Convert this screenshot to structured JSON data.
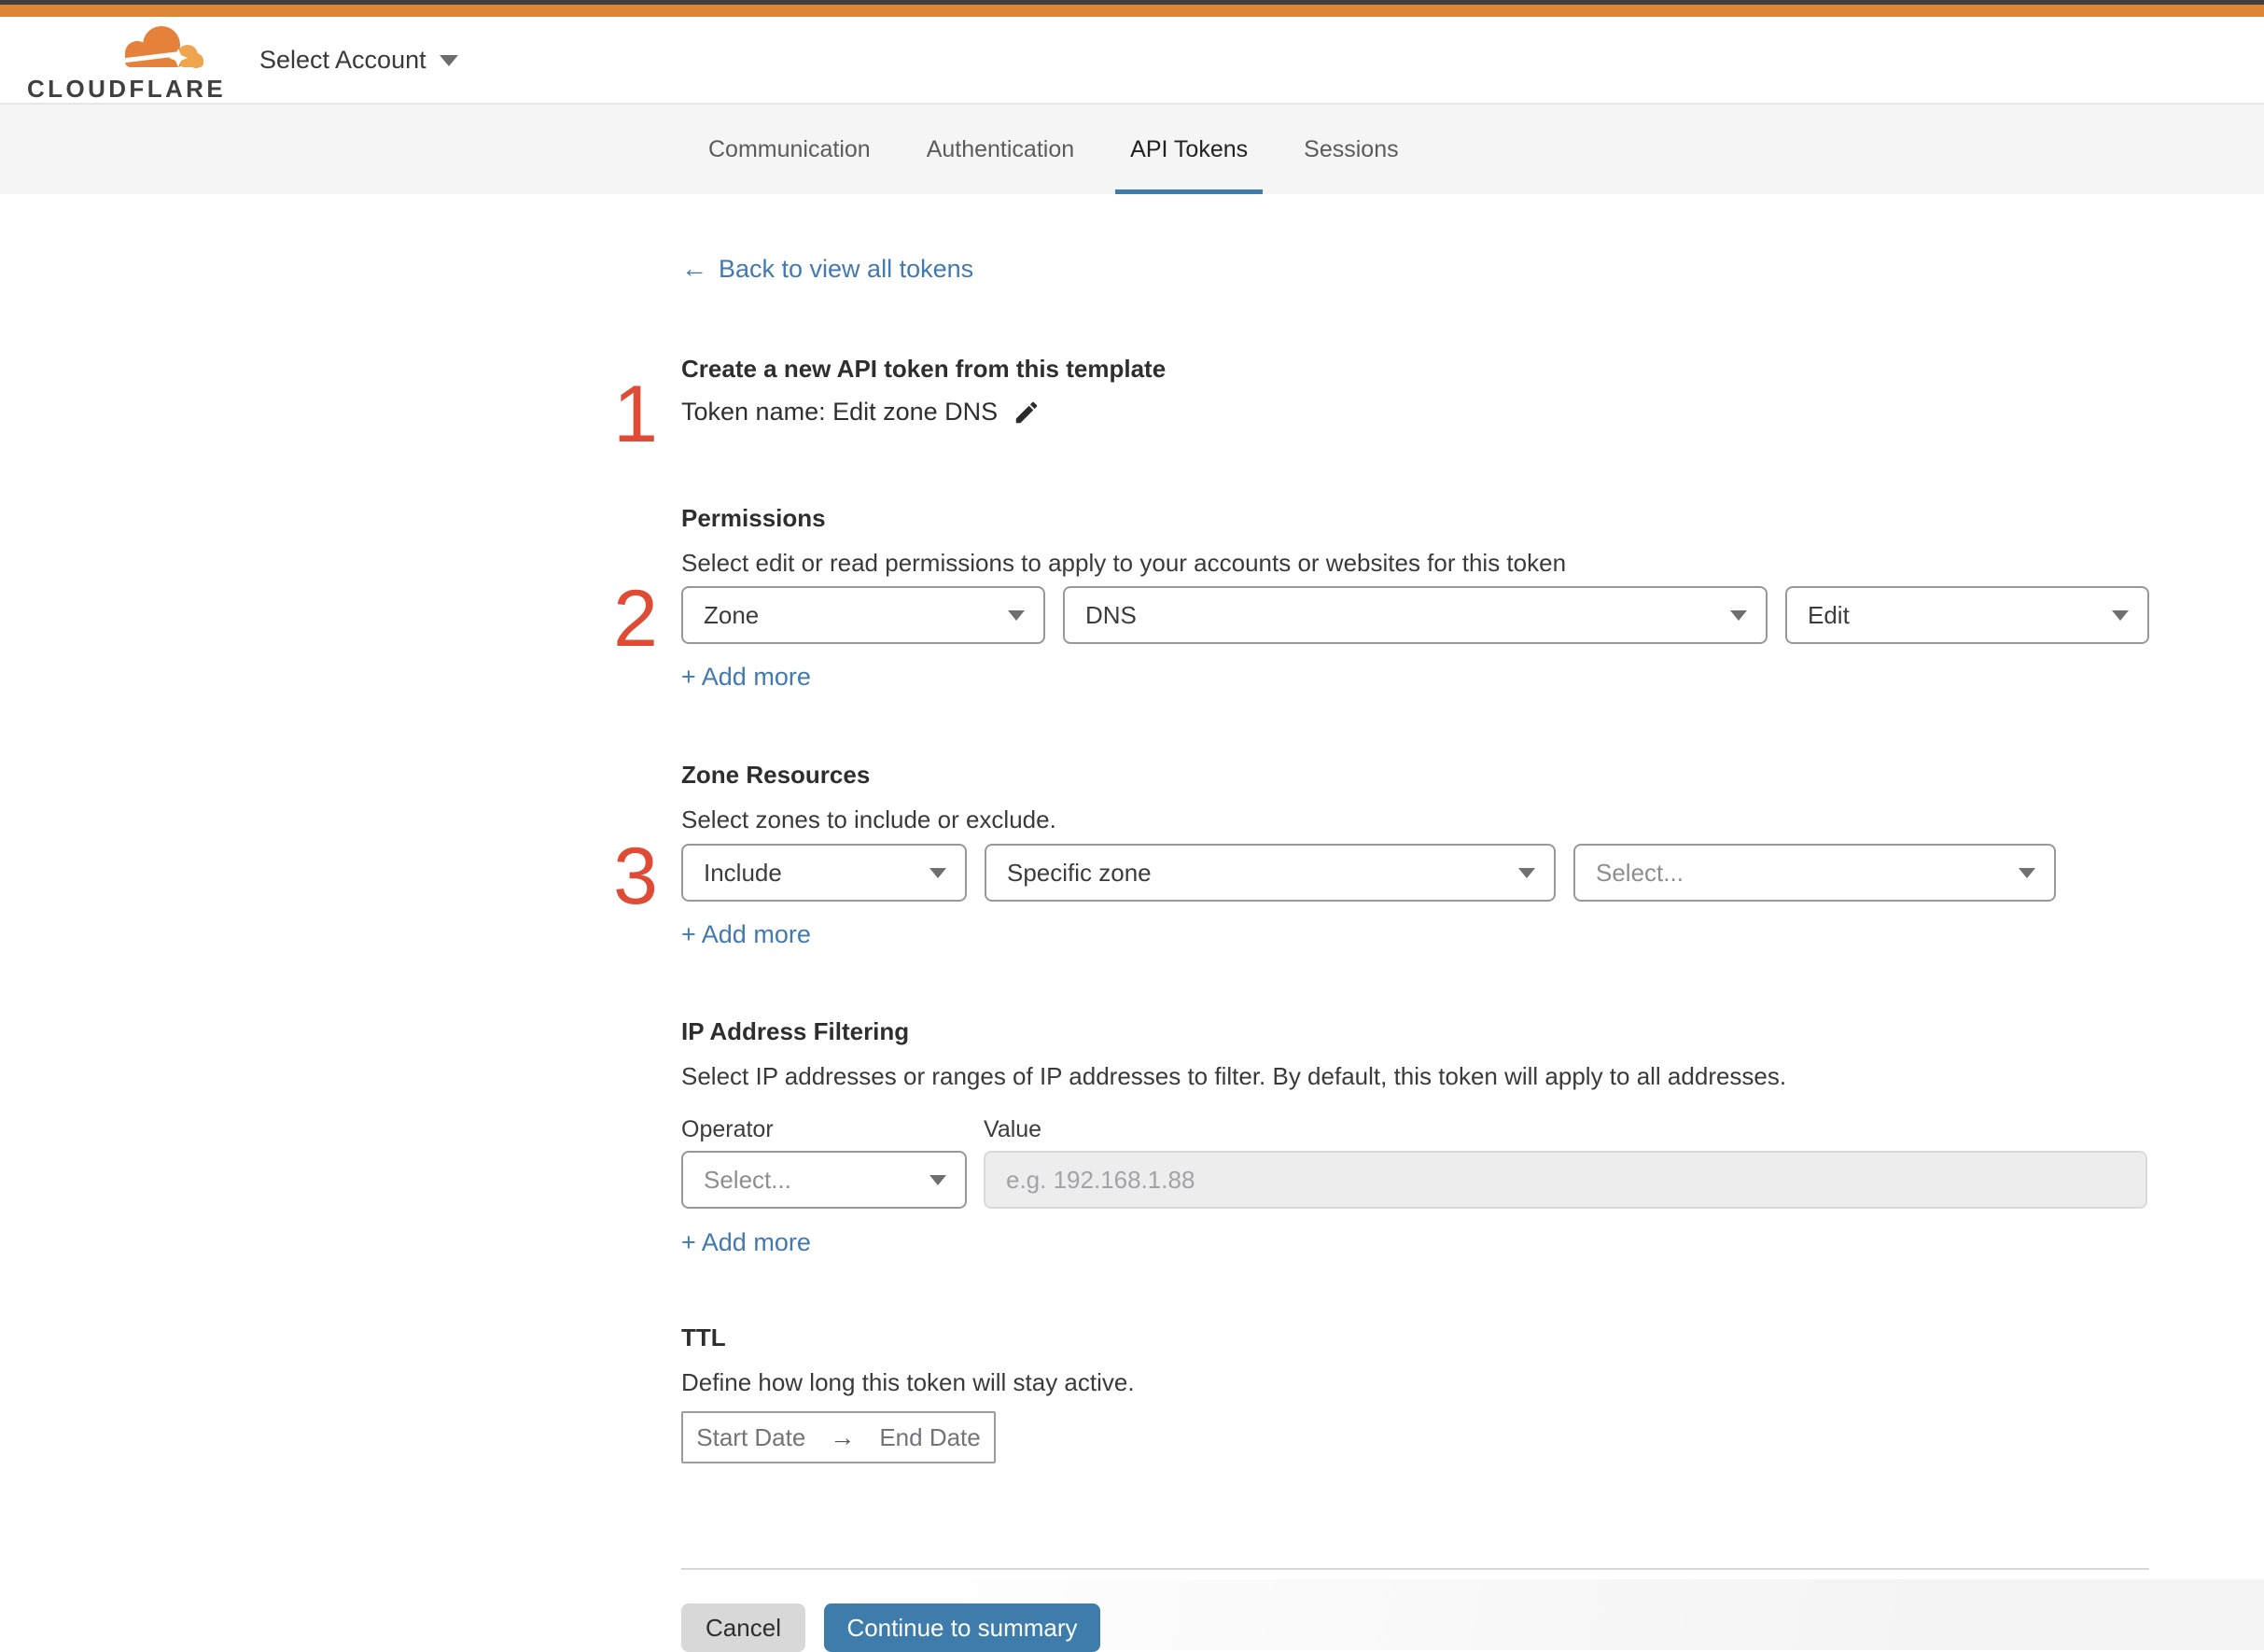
{
  "header": {
    "logo_text": "CLOUDFLARE",
    "account_selector_label": "Select Account"
  },
  "tabs": {
    "items": [
      {
        "label": "Communication",
        "active": false
      },
      {
        "label": "Authentication",
        "active": false
      },
      {
        "label": "API Tokens",
        "active": true
      },
      {
        "label": "Sessions",
        "active": false
      }
    ]
  },
  "back_link": {
    "arrow": "←",
    "label": "Back to view all tokens"
  },
  "steps": {
    "create": {
      "number": "1",
      "title": "Create a new API token from this template",
      "token_name": "Token name: Edit zone DNS"
    },
    "permissions": {
      "number": "2",
      "title": "Permissions",
      "description": "Select edit or read permissions to apply to your accounts or websites for this token",
      "dropdown_scope": "Zone",
      "dropdown_service": "DNS",
      "dropdown_access": "Edit",
      "add_more": "+ Add more"
    },
    "zone_resources": {
      "number": "3",
      "title": "Zone Resources",
      "description": "Select zones to include or exclude.",
      "dropdown_mode": "Include",
      "dropdown_type": "Specific zone",
      "dropdown_zone_placeholder": "Select...",
      "add_more": "+ Add more"
    },
    "ip_filtering": {
      "title": "IP Address Filtering",
      "description": "Select IP addresses or ranges of IP addresses to filter. By default, this token will apply to all addresses.",
      "operator_label": "Operator",
      "value_label": "Value",
      "operator_placeholder": "Select...",
      "value_placeholder": "e.g. 192.168.1.88",
      "add_more": "+ Add more"
    },
    "ttl": {
      "title": "TTL",
      "description": "Define how long this token will stay active.",
      "start_date": "Start Date",
      "range_arrow": "→",
      "end_date": "End Date"
    }
  },
  "footer": {
    "cancel_label": "Cancel",
    "continue_label": "Continue to summary"
  },
  "colors": {
    "accent_orange": "#dd8636",
    "link_blue": "#4379b1",
    "button_blue": "#3e7cab",
    "step_red": "#e04b35",
    "tabbar_bg": "#f5f5f6"
  }
}
